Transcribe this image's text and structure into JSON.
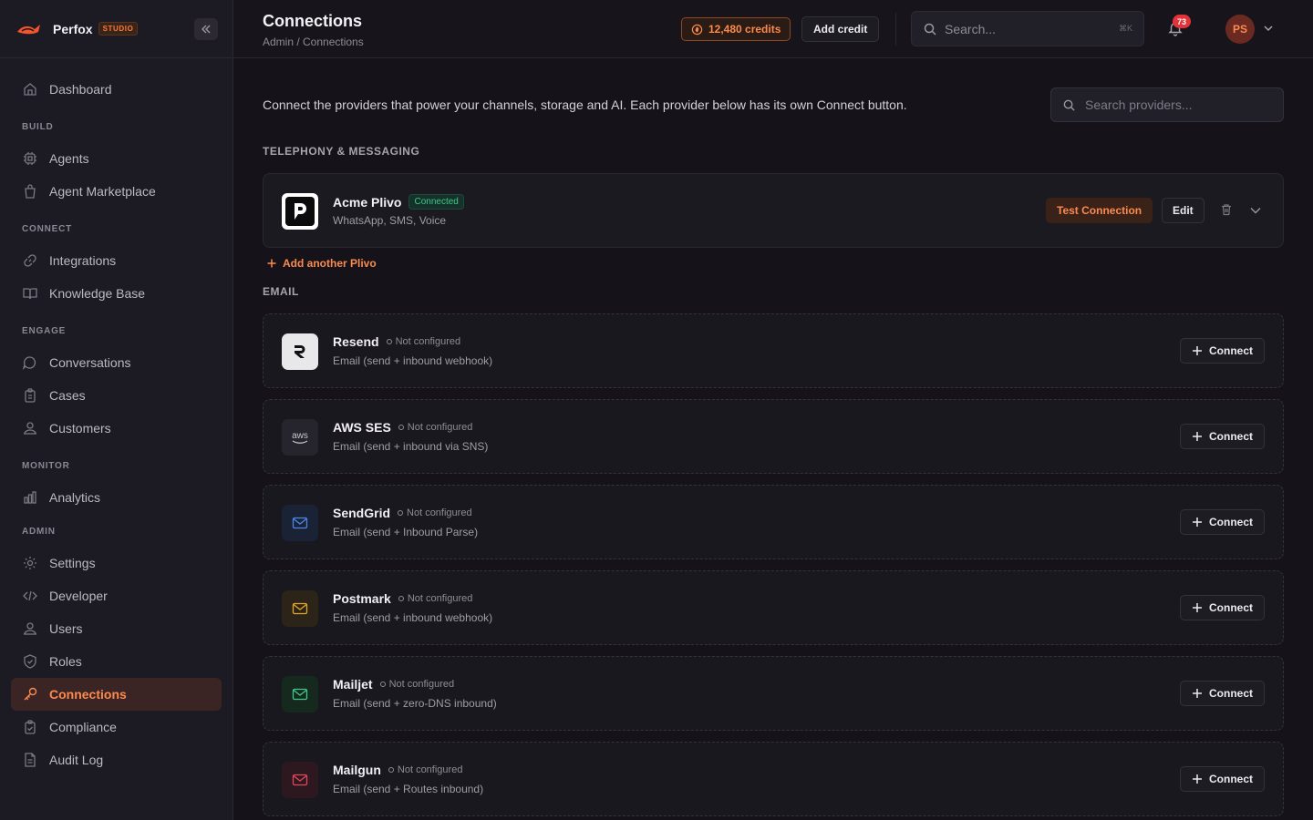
{
  "brand": {
    "name": "Perfox",
    "badge": "STUDIO"
  },
  "sidebar": {
    "top_items": [
      {
        "label": "Dashboard",
        "icon": "home-icon"
      }
    ],
    "sections": [
      {
        "title": "BUILD",
        "items": [
          {
            "label": "Agents",
            "icon": "cpu-icon"
          },
          {
            "label": "Agent Marketplace",
            "icon": "bag-icon"
          }
        ]
      },
      {
        "title": "CONNECT",
        "items": [
          {
            "label": "Integrations",
            "icon": "link-icon"
          },
          {
            "label": "Knowledge Base",
            "icon": "book-icon"
          }
        ]
      },
      {
        "title": "ENGAGE",
        "items": [
          {
            "label": "Conversations",
            "icon": "chat-icon"
          },
          {
            "label": "Cases",
            "icon": "clipboard-icon"
          },
          {
            "label": "Customers",
            "icon": "users-icon"
          }
        ]
      },
      {
        "title": "MONITOR",
        "items": [
          {
            "label": "Analytics",
            "icon": "chart-icon"
          }
        ]
      },
      {
        "title": "ADMIN",
        "items": [
          {
            "label": "Settings",
            "icon": "gear-icon"
          },
          {
            "label": "Developer",
            "icon": "code-icon"
          },
          {
            "label": "Users",
            "icon": "users-icon"
          },
          {
            "label": "Roles",
            "icon": "shield-icon"
          },
          {
            "label": "Connections",
            "icon": "key-icon",
            "active": true
          },
          {
            "label": "Compliance",
            "icon": "clipboard-check-icon"
          },
          {
            "label": "Audit Log",
            "icon": "document-icon"
          }
        ]
      }
    ]
  },
  "header": {
    "title": "Connections",
    "breadcrumb": "Admin / Connections",
    "credits": "12,480 credits",
    "add_credit": "Add credit",
    "search_placeholder": "Search...",
    "search_shortcut": "⌘K",
    "notification_count": "73",
    "avatar_initials": "PS"
  },
  "main": {
    "intro": "Connect the providers that power your channels, storage and AI. Each provider below has its own Connect button.",
    "provider_search_placeholder": "Search providers...",
    "groups": {
      "telephony": "TELEPHONY & MESSAGING",
      "email": "EMAIL"
    },
    "connected": {
      "name": "Acme Plivo",
      "status": "Connected",
      "desc": "WhatsApp, SMS, Voice",
      "test_label": "Test Connection",
      "edit_label": "Edit",
      "add_another": "Add another Plivo"
    },
    "connect_label": "Connect",
    "not_configured": "Not configured",
    "providers": [
      {
        "name": "Resend",
        "desc": "Email (send + inbound webhook)",
        "accent": "#ffffff"
      },
      {
        "name": "AWS SES",
        "desc": "Email (send + inbound via SNS)",
        "accent": "#c9c5cf"
      },
      {
        "name": "SendGrid",
        "desc": "Email (send + Inbound Parse)",
        "accent": "#4f86e8"
      },
      {
        "name": "Postmark",
        "desc": "Email (send + inbound webhook)",
        "accent": "#e3a62b"
      },
      {
        "name": "Mailjet",
        "desc": "Email (send + zero-DNS inbound)",
        "accent": "#3ec98a"
      },
      {
        "name": "Mailgun",
        "desc": "Email (send + Routes inbound)",
        "accent": "#e0485a"
      }
    ]
  },
  "colors": {
    "accent": "#fb8a4e",
    "success": "#3ec98a",
    "badge": "#e0343a"
  }
}
